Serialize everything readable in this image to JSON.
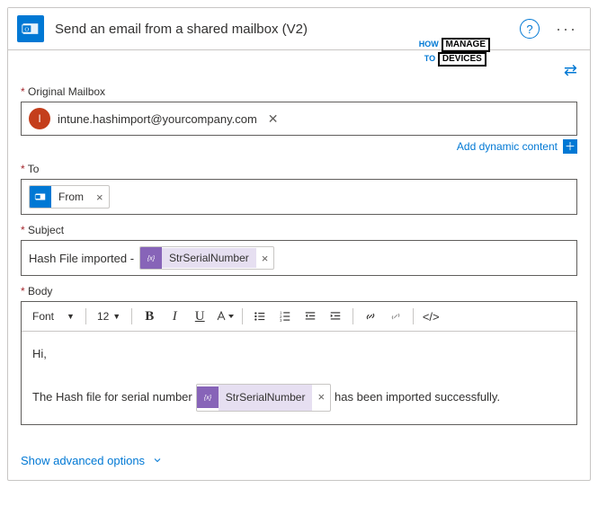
{
  "header": {
    "title": "Send an email from a shared mailbox (V2)"
  },
  "mailbox": {
    "label": "Original Mailbox",
    "chip_initial": "I",
    "chip_email": "intune.hashimport@yourcompany.com"
  },
  "dynamic_link": "Add dynamic content",
  "to": {
    "label": "To",
    "token_label": "From"
  },
  "subject": {
    "label": "Subject",
    "prefix": "Hash File imported - ",
    "token_label": "StrSerialNumber"
  },
  "bodyfield": {
    "label": "Body",
    "font_label": "Font",
    "size_label": "12",
    "greeting": "Hi,",
    "line_before": "The Hash file for serial number",
    "token_label": "StrSerialNumber",
    "line_after": "has been imported successfully."
  },
  "advanced": "Show advanced options",
  "watermark": {
    "l1": "HOW",
    "l2": "MANAGE",
    "l3": "TO",
    "l4": "DEVICES"
  }
}
